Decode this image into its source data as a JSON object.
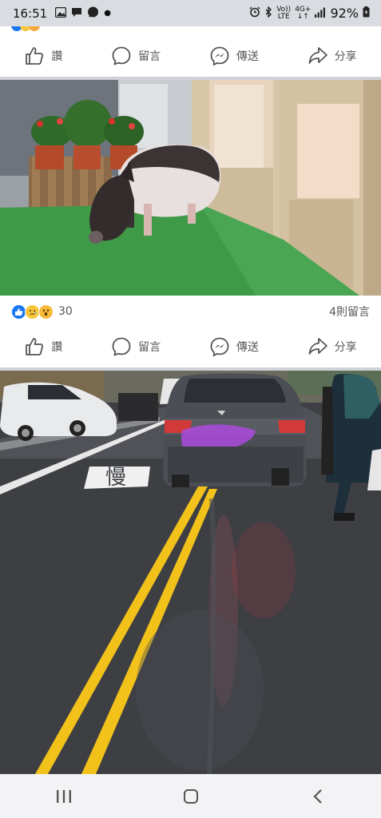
{
  "status_bar": {
    "time": "16:51",
    "network_label_top": "Vo))",
    "network_label_bottom": "LTE",
    "network_gen_top": "4G+",
    "network_gen_bottom": "↓↑",
    "battery_percent": "92%"
  },
  "post_actions_top": {
    "like": "讚",
    "comment": "留言",
    "send": "傳送",
    "share": "分享"
  },
  "reactions": {
    "icons": [
      "like-icon",
      "sad-icon",
      "wow-icon"
    ],
    "count": "30",
    "comments": "4則留言"
  },
  "post_actions_bottom": {
    "like": "讚",
    "comment": "留言",
    "send": "傳送",
    "share": "分享"
  },
  "photos": [
    {
      "subject": "pig-indoor-photo"
    },
    {
      "subject": "street-car-photo",
      "road_marking": "慢"
    }
  ],
  "colors": {
    "status_bar_bg": "#d9dce1",
    "separator": "#cfd2d8",
    "like_blue": "#1877f2",
    "reaction_yellow": "#f7c63a",
    "road_yellow": "#f2c21b"
  }
}
